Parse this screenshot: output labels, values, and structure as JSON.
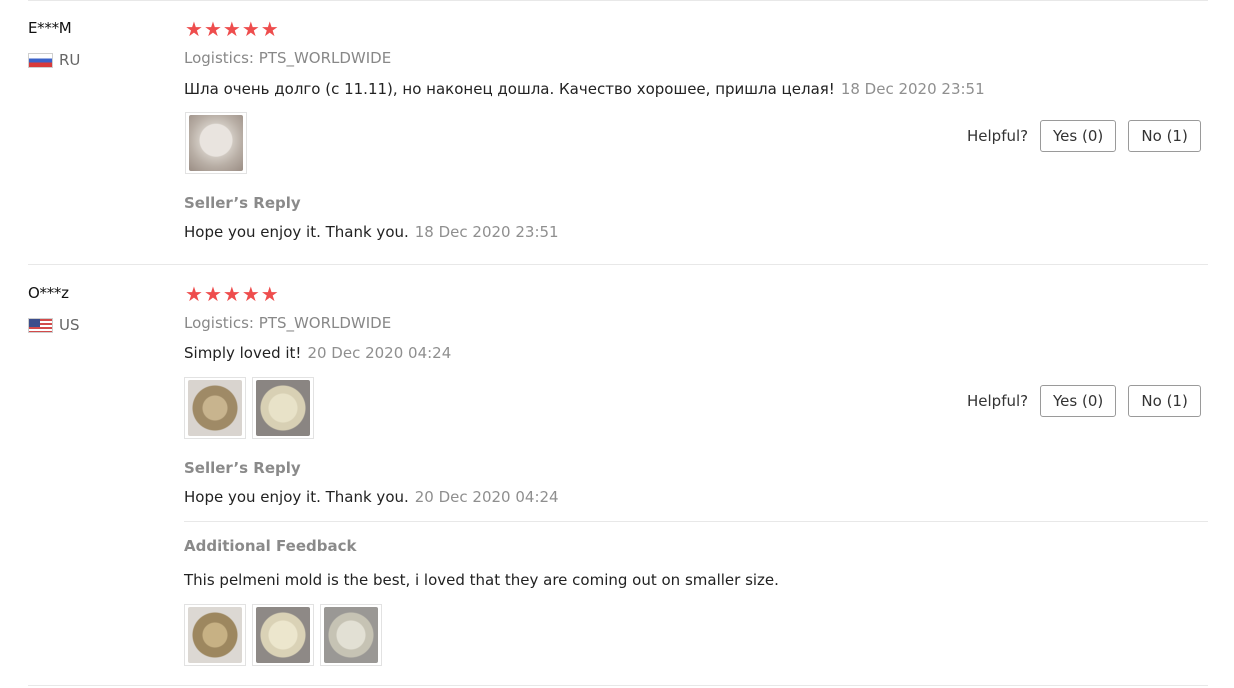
{
  "helpful_label": "Helpful?",
  "logistics_label": "Logistics:",
  "reviews": [
    {
      "user": "E***M",
      "country": "RU",
      "logistics": "PTS_WORLDWIDE",
      "text": "Шла очень долго (с 11.11), но наконец дошла. Качество хорошее, пришла целая!",
      "date": "18 Dec 2020 23:51",
      "yes": "Yes (0)",
      "no": "No (1)",
      "reply_title": "Seller’s Reply",
      "reply_text": "Hope you enjoy it. Thank you.",
      "reply_date": "18 Dec 2020 23:51"
    },
    {
      "user": "O***z",
      "country": "US",
      "logistics": "PTS_WORLDWIDE",
      "text": "Simply loved it!",
      "date": "20 Dec 2020 04:24",
      "yes": "Yes (0)",
      "no": "No (1)",
      "reply_title": "Seller’s Reply",
      "reply_text": "Hope you enjoy it. Thank you.",
      "reply_date": "20 Dec 2020 04:24",
      "additional_title": "Additional Feedback",
      "additional_text": "This pelmeni mold is the best, i loved that they are coming out on smaller size."
    }
  ],
  "colors": {
    "star": "#ee4d4d",
    "muted": "#888888",
    "border": "#9a9a9a"
  }
}
